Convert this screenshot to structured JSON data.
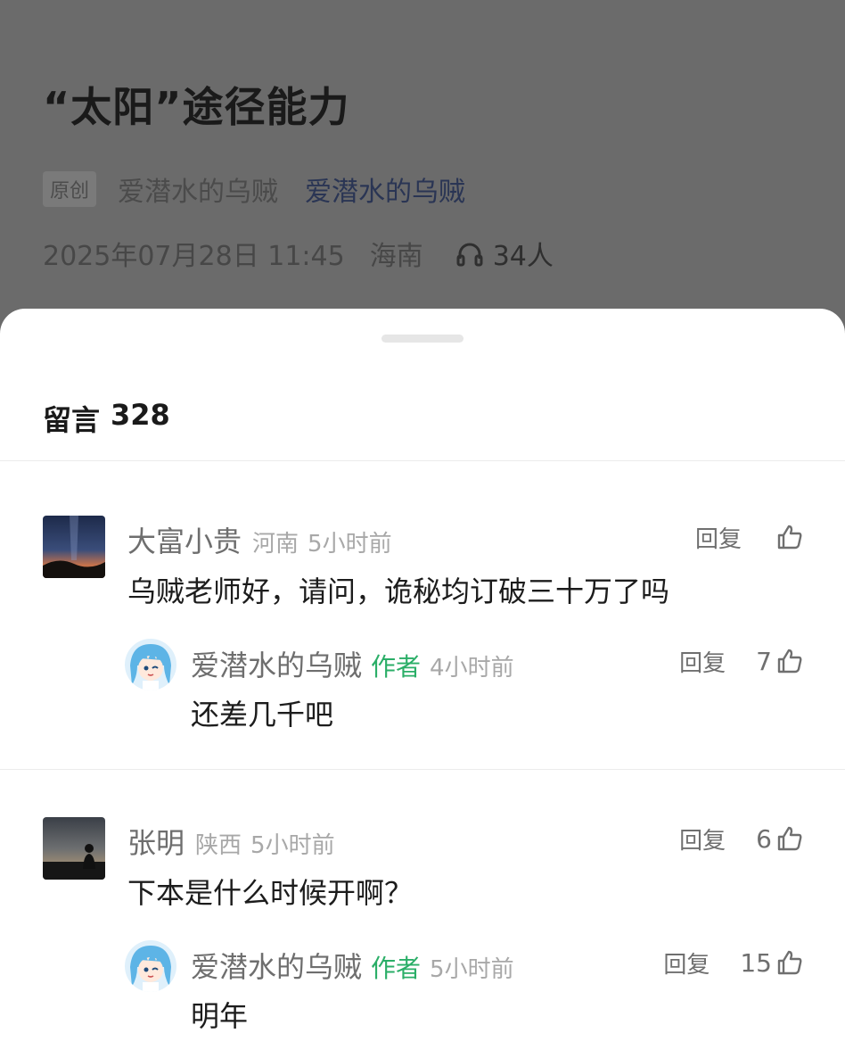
{
  "article": {
    "title": "“太阳”途径能力",
    "original_tag": "原创",
    "author": "爱潜水的乌贼",
    "account": "爱潜水的乌贼",
    "datetime": "2025年07月28日 11:45",
    "location": "海南",
    "listeners": "34人",
    "listen_icon": "headphones-icon"
  },
  "comments_header": {
    "label": "留言",
    "count": "328"
  },
  "comments": [
    {
      "name": "大富小贵",
      "region": "河南",
      "time": "5小时前",
      "text": "乌贼老师好，请问，诡秘均订破三十万了吗",
      "reply_label": "回复",
      "likes": "",
      "reply": {
        "name": "爱潜水的乌贼",
        "badge": "作者",
        "time": "4小时前",
        "text": "还差几千吧",
        "reply_label": "回复",
        "likes": "7"
      }
    },
    {
      "name": "张明",
      "region": "陕西",
      "time": "5小时前",
      "text": "下本是什么时候开啊？",
      "reply_label": "回复",
      "likes": "6",
      "reply": {
        "name": "爱潜水的乌贼",
        "badge": "作者",
        "time": "5小时前",
        "text": "明年",
        "reply_label": "回复",
        "likes": "15"
      }
    }
  ],
  "colors": {
    "author_badge": "#2aae67",
    "overlay": "#6b6b6b"
  }
}
